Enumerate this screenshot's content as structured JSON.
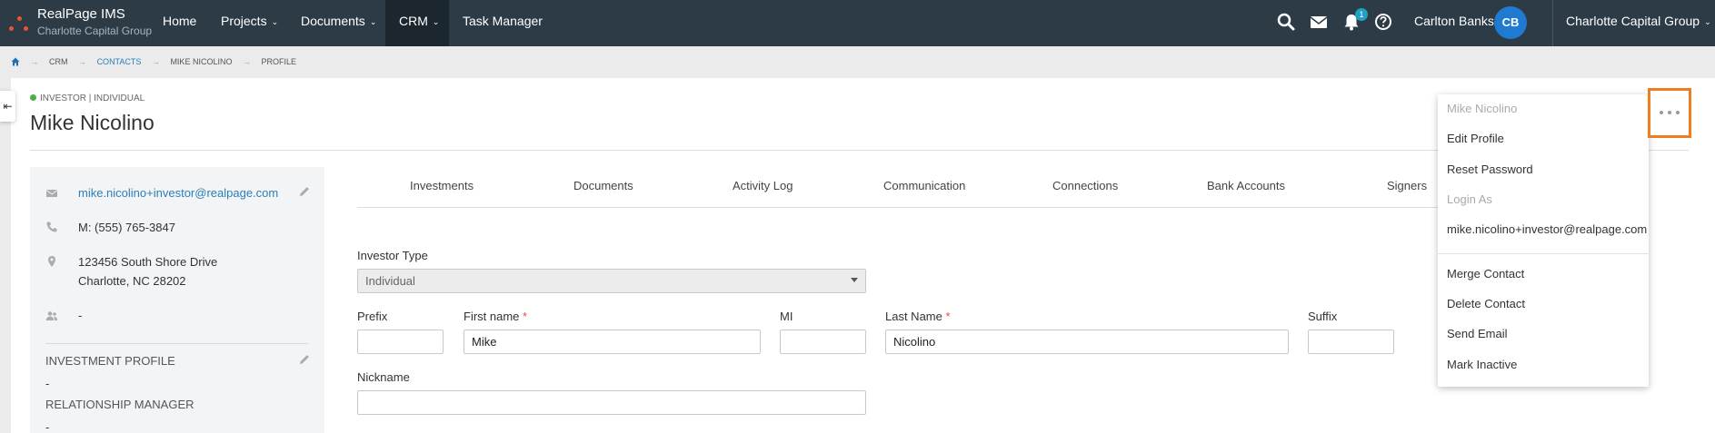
{
  "brand": {
    "title": "RealPage IMS",
    "subtitle": "Charlotte Capital Group"
  },
  "nav": {
    "home": "Home",
    "projects": "Projects",
    "documents": "Documents",
    "crm": "CRM",
    "task_manager": "Task Manager",
    "caret": "⌄",
    "notification_count": "1",
    "user_name": "Carlton Banks",
    "avatar_initials": "CB",
    "company": "Charlotte Capital Group",
    "icons": [
      "search-icon",
      "mail-icon",
      "bell-icon",
      "help-icon"
    ]
  },
  "breadcrumb": {
    "items": [
      "CRM",
      "CONTACTS",
      "MIKE NICOLINO",
      "PROFILE"
    ],
    "separator": "→"
  },
  "profile": {
    "type_label": "INVESTOR | INDIVIDUAL",
    "name": "Mike Nicolino",
    "status_color": "#4cae4c"
  },
  "side_panel": {
    "email": "mike.nicolino+investor@realpage.com",
    "phone": "M: (555) 765-3847",
    "address_line1": "123456 South Shore Drive",
    "address_line2": "Charlotte, NC 28202",
    "group_value": "-",
    "investment_profile_label": "INVESTMENT PROFILE",
    "investment_profile_value": "-",
    "relationship_manager_label": "RELATIONSHIP MANAGER",
    "relationship_manager_value": "-"
  },
  "tabs": [
    "Investments",
    "Documents",
    "Activity Log",
    "Communication",
    "Connections",
    "Bank Accounts",
    "Signers"
  ],
  "form": {
    "investor_type_label": "Investor Type",
    "investor_type_value": "Individual",
    "prefix_label": "Prefix",
    "prefix_value": "",
    "first_name_label": "First name",
    "first_name_value": "Mike",
    "mi_label": "MI",
    "mi_value": "",
    "last_name_label": "Last Name",
    "last_name_value": "Nicolino",
    "suffix_label": "Suffix",
    "suffix_value": "",
    "nickname_label": "Nickname",
    "nickname_value": "",
    "required_mark": "*"
  },
  "menu": {
    "header": "Mike Nicolino",
    "edit_profile": "Edit Profile",
    "reset_password": "Reset Password",
    "login_as": "Login As",
    "login_email": "mike.nicolino+investor@realpage.com",
    "merge_contact": "Merge Contact",
    "delete_contact": "Delete Contact",
    "send_email": "Send Email",
    "mark_inactive": "Mark Inactive"
  },
  "colors": {
    "nav_bg": "#2d3b47",
    "accent_orange": "#f07c22",
    "link_blue": "#2a7fb8",
    "avatar_blue": "#1f7ad1"
  }
}
